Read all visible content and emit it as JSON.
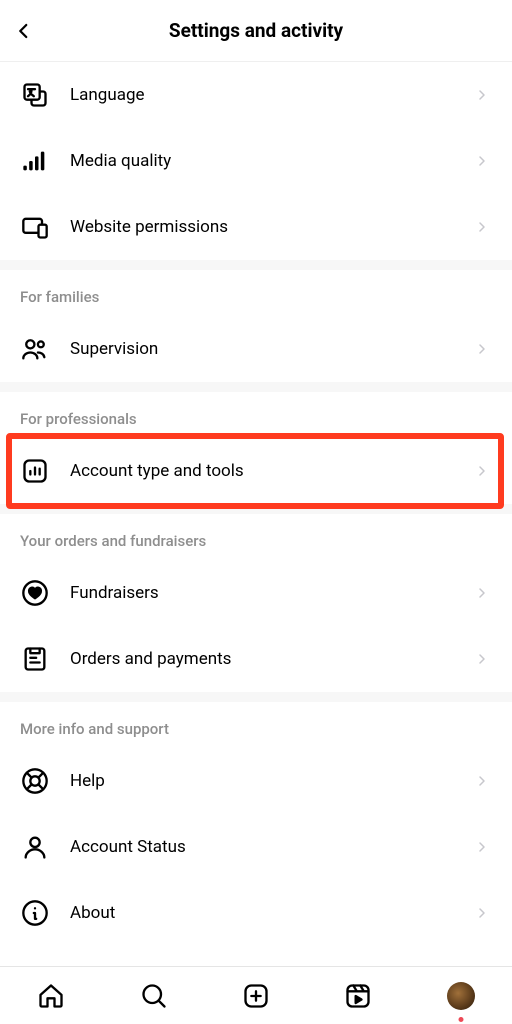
{
  "header": {
    "title": "Settings and activity"
  },
  "items": {
    "language": "Language",
    "media_quality": "Media quality",
    "website_permissions": "Website permissions",
    "supervision": "Supervision",
    "account_type": "Account type and tools",
    "fundraisers": "Fundraisers",
    "orders": "Orders and payments",
    "help": "Help",
    "account_status": "Account Status",
    "about": "About"
  },
  "sections": {
    "families": "For families",
    "professionals": "For professionals",
    "orders_fundraisers": "Your orders and fundraisers",
    "more_info": "More info and support"
  },
  "highlighted_item": "account_type"
}
